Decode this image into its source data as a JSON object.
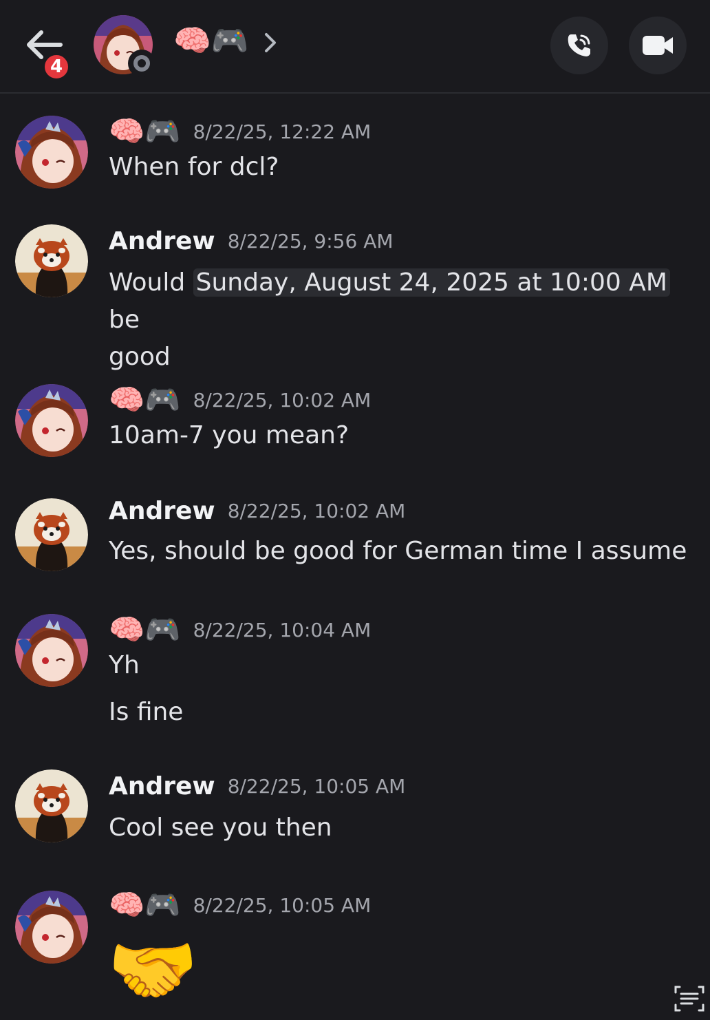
{
  "header": {
    "badge_count": "4",
    "channel_name": "🧠🎮",
    "chevron": "›"
  },
  "icons": {
    "back": "arrow-left-icon",
    "call": "phone-call-icon",
    "video": "video-camera-icon",
    "scan": "scan-text-icon"
  },
  "colors": {
    "background": "#1a1a1e",
    "badge": "#e4373d",
    "timestamp": "#a4a6ad",
    "status_offline": "#80848e"
  },
  "messages": [
    {
      "author": "🧠🎮",
      "timestamp": "8/22/25, 12:22 AM",
      "lines": [
        "When for dcl?"
      ]
    },
    {
      "author": "Andrew",
      "timestamp": "8/22/25, 9:56 AM",
      "text_before": "Would ",
      "date_chip": "Sunday, August 24, 2025 at 10:00 AM",
      "text_after": " be",
      "line2": "good"
    },
    {
      "author": "🧠🎮",
      "timestamp": "8/22/25, 10:02 AM",
      "lines": [
        "10am-7 you mean?"
      ]
    },
    {
      "author": "Andrew",
      "timestamp": "8/22/25, 10:02 AM",
      "lines": [
        "Yes, should be good for German time I assume"
      ]
    },
    {
      "author": "🧠🎮",
      "timestamp": "8/22/25, 10:04 AM",
      "lines": [
        "Yh",
        "Is fine"
      ]
    },
    {
      "author": "Andrew",
      "timestamp": "8/22/25, 10:05 AM",
      "lines": [
        "Cool see you then"
      ]
    },
    {
      "author": "🧠🎮",
      "timestamp": "8/22/25, 10:05 AM",
      "emoji": "🤝"
    }
  ]
}
